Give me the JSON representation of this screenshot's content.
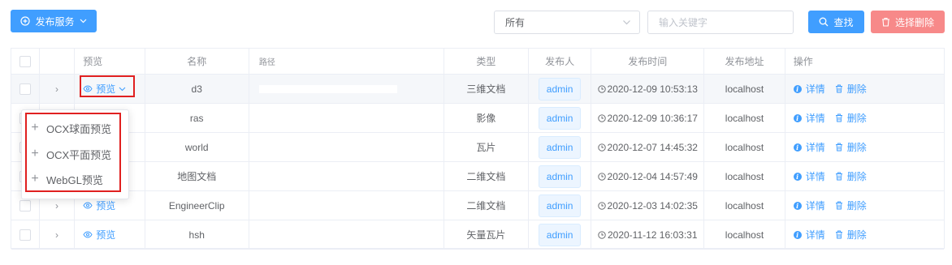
{
  "toolbar": {
    "publish_label": "发布服务",
    "filter_value": "所有",
    "search_placeholder": "输入关键字",
    "search_label": "查找",
    "batch_delete_label": "选择删除"
  },
  "table": {
    "columns": [
      "预览",
      "名称",
      "路径",
      "类型",
      "发布人",
      "发布时间",
      "发布地址",
      "操作"
    ],
    "rows": [
      {
        "preview": "预览",
        "name": "d3",
        "path": "",
        "type": "三维文档",
        "user": "admin",
        "time": "2020-12-09 10:53:13",
        "addr": "localhost"
      },
      {
        "preview": "预览",
        "name": "ras",
        "path": "",
        "type": "影像",
        "user": "admin",
        "time": "2020-12-09 10:36:17",
        "addr": "localhost"
      },
      {
        "preview": "预览",
        "name": "world",
        "path": "",
        "type": "瓦片",
        "user": "admin",
        "time": "2020-12-07 14:45:32",
        "addr": "localhost"
      },
      {
        "preview": "预览",
        "name": "地图文档",
        "path": "",
        "type": "二维文档",
        "user": "admin",
        "time": "2020-12-04 14:57:49",
        "addr": "localhost"
      },
      {
        "preview": "预览",
        "name": "EngineerClip",
        "path": "",
        "type": "二维文档",
        "user": "admin",
        "time": "2020-12-03 14:02:35",
        "addr": "localhost"
      },
      {
        "preview": "预览",
        "name": "hsh",
        "path": "",
        "type": "矢量瓦片",
        "user": "admin",
        "time": "2020-11-12 16:03:31",
        "addr": "localhost"
      }
    ],
    "op_detail": "详情",
    "op_delete": "删除"
  },
  "preview_menu": {
    "items": [
      "OCX球面预览",
      "OCX平面预览",
      "WebGL预览"
    ]
  },
  "colors": {
    "primary": "#409eff",
    "danger": "#f78989",
    "highlight": "#e02020"
  }
}
